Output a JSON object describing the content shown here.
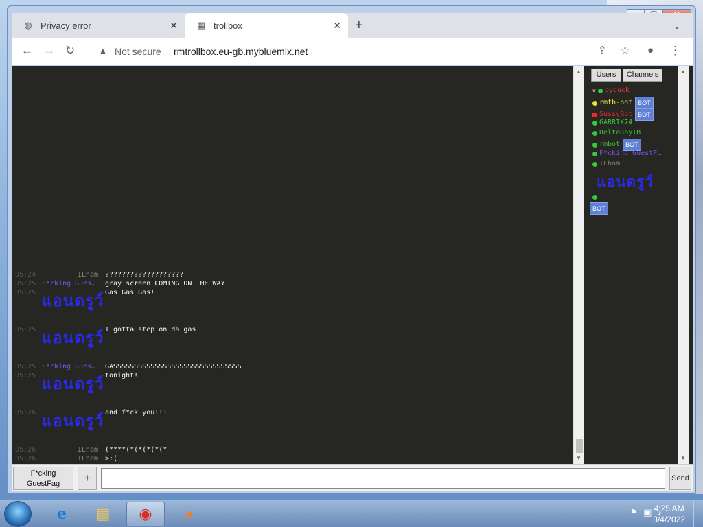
{
  "browser": {
    "tabs": [
      {
        "title": "Privacy error",
        "icon": "globe-icon"
      },
      {
        "title": "trollbox",
        "icon": "trollbox-favicon"
      }
    ],
    "security_label": "Not secure",
    "url": "rmtrollbox.eu-gb.mybluemix.net"
  },
  "chat": {
    "messages": [
      {
        "time": "05:24",
        "nick": "ILham",
        "text": "???????????????????"
      },
      {
        "time": "05:25",
        "nick": "F*cking Gues…",
        "text": "gray screen COMING ON THE WAY"
      },
      {
        "time": "05:25",
        "nick": "แอนดรูว์",
        "text": "Gas Gas Gas!"
      },
      {
        "time": "05:25",
        "nick": "แอนดรูว์",
        "text": "I gotta step on da gas!"
      },
      {
        "time": "05:25",
        "nick": "F*cking Gues…",
        "text": "GASSSSSSSSSSSSSSSSSSSSSSSSSSSSSSS"
      },
      {
        "time": "05:25",
        "nick": "แอนดรูว์",
        "text": "tonight!"
      },
      {
        "time": "05:26",
        "nick": "แอนดรูว์",
        "text": "and f*ck you!!1"
      },
      {
        "time": "05:26",
        "nick": "ILham",
        "text": "(****(*(*(*(*(*"
      },
      {
        "time": "05:26",
        "nick": "ILham",
        "text": ">:("
      }
    ]
  },
  "sidebar": {
    "tabs": [
      "Users",
      "Channels"
    ],
    "users": [
      {
        "name": "pyduck",
        "color": "#e83a3a",
        "bot": false
      },
      {
        "name": "rmtb-bot",
        "color": "#e8e23a",
        "bot": true
      },
      {
        "name": "SussyBot",
        "color": "#e82a2a",
        "bot": true
      },
      {
        "name": "GARRIX74",
        "color": "#3ac83a",
        "bot": false
      },
      {
        "name": "DeltaRayTB",
        "color": "#3ac83a",
        "bot": false
      },
      {
        "name": "rmbot",
        "color": "#3ac83a",
        "bot": true
      },
      {
        "name": "F*cking GuestF…",
        "color": "#7a55e8",
        "bot": false
      },
      {
        "name": "ILham",
        "color": "#3ac83a",
        "bot": false
      },
      {
        "name": "แอนดรูว์",
        "color": "#2a2ae8",
        "bot": false
      },
      {
        "name": "",
        "color": "#3ac83a",
        "bot": true
      }
    ],
    "bot_label": "BOT"
  },
  "input": {
    "nick_label": "F*cking GuestFag",
    "plus_label": "+",
    "send_label": "Send",
    "value": ""
  },
  "taskbar": {
    "time": "4:25 AM",
    "date": "3/4/2022"
  }
}
